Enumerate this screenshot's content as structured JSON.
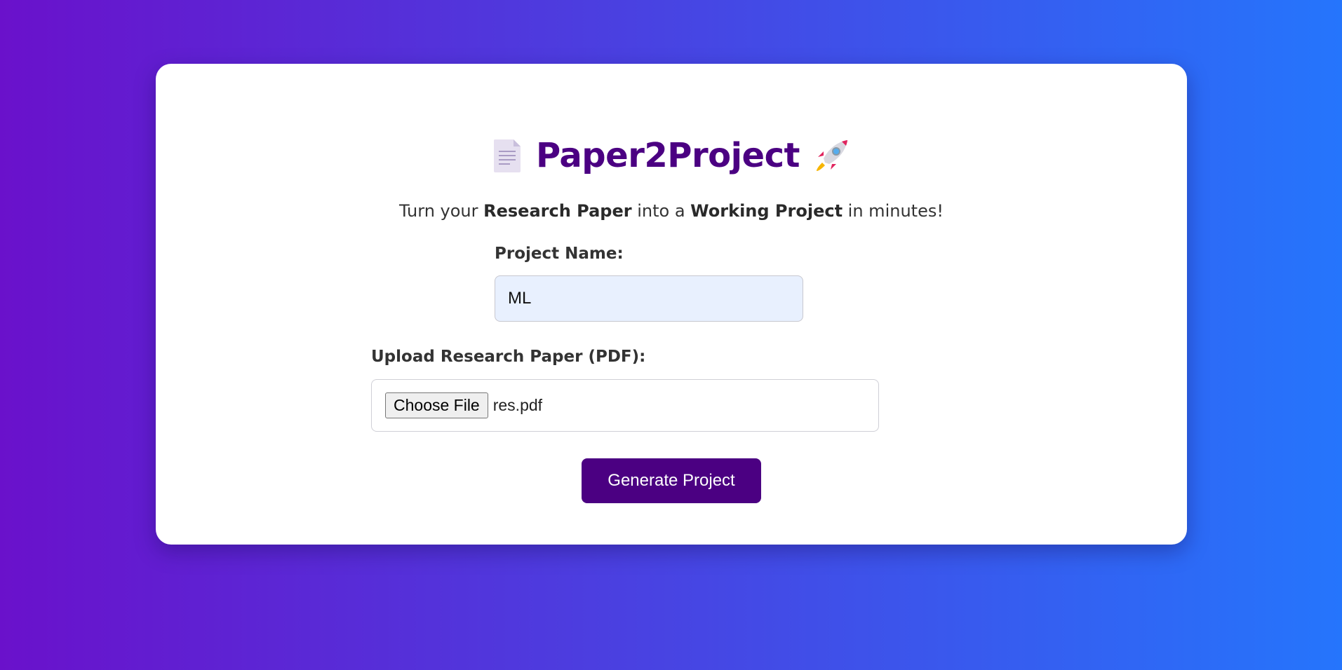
{
  "header": {
    "title": "Paper2Project",
    "left_icon": "document-icon",
    "right_icon": "rocket-icon"
  },
  "subtitle": {
    "part1": "Turn your ",
    "bold1": "Research Paper",
    "part2": " into a ",
    "bold2": "Working Project",
    "part3": " in minutes!"
  },
  "form": {
    "project_name_label": "Project Name:",
    "project_name_value": "ML",
    "upload_label": "Upload Research Paper (PDF):",
    "choose_file_label": "Choose File",
    "file_name": "res.pdf",
    "submit_label": "Generate Project"
  },
  "colors": {
    "accent": "#4b0082",
    "gradient_start": "#6a11cb",
    "gradient_end": "#2575fc",
    "input_bg": "#e8f0fe"
  }
}
